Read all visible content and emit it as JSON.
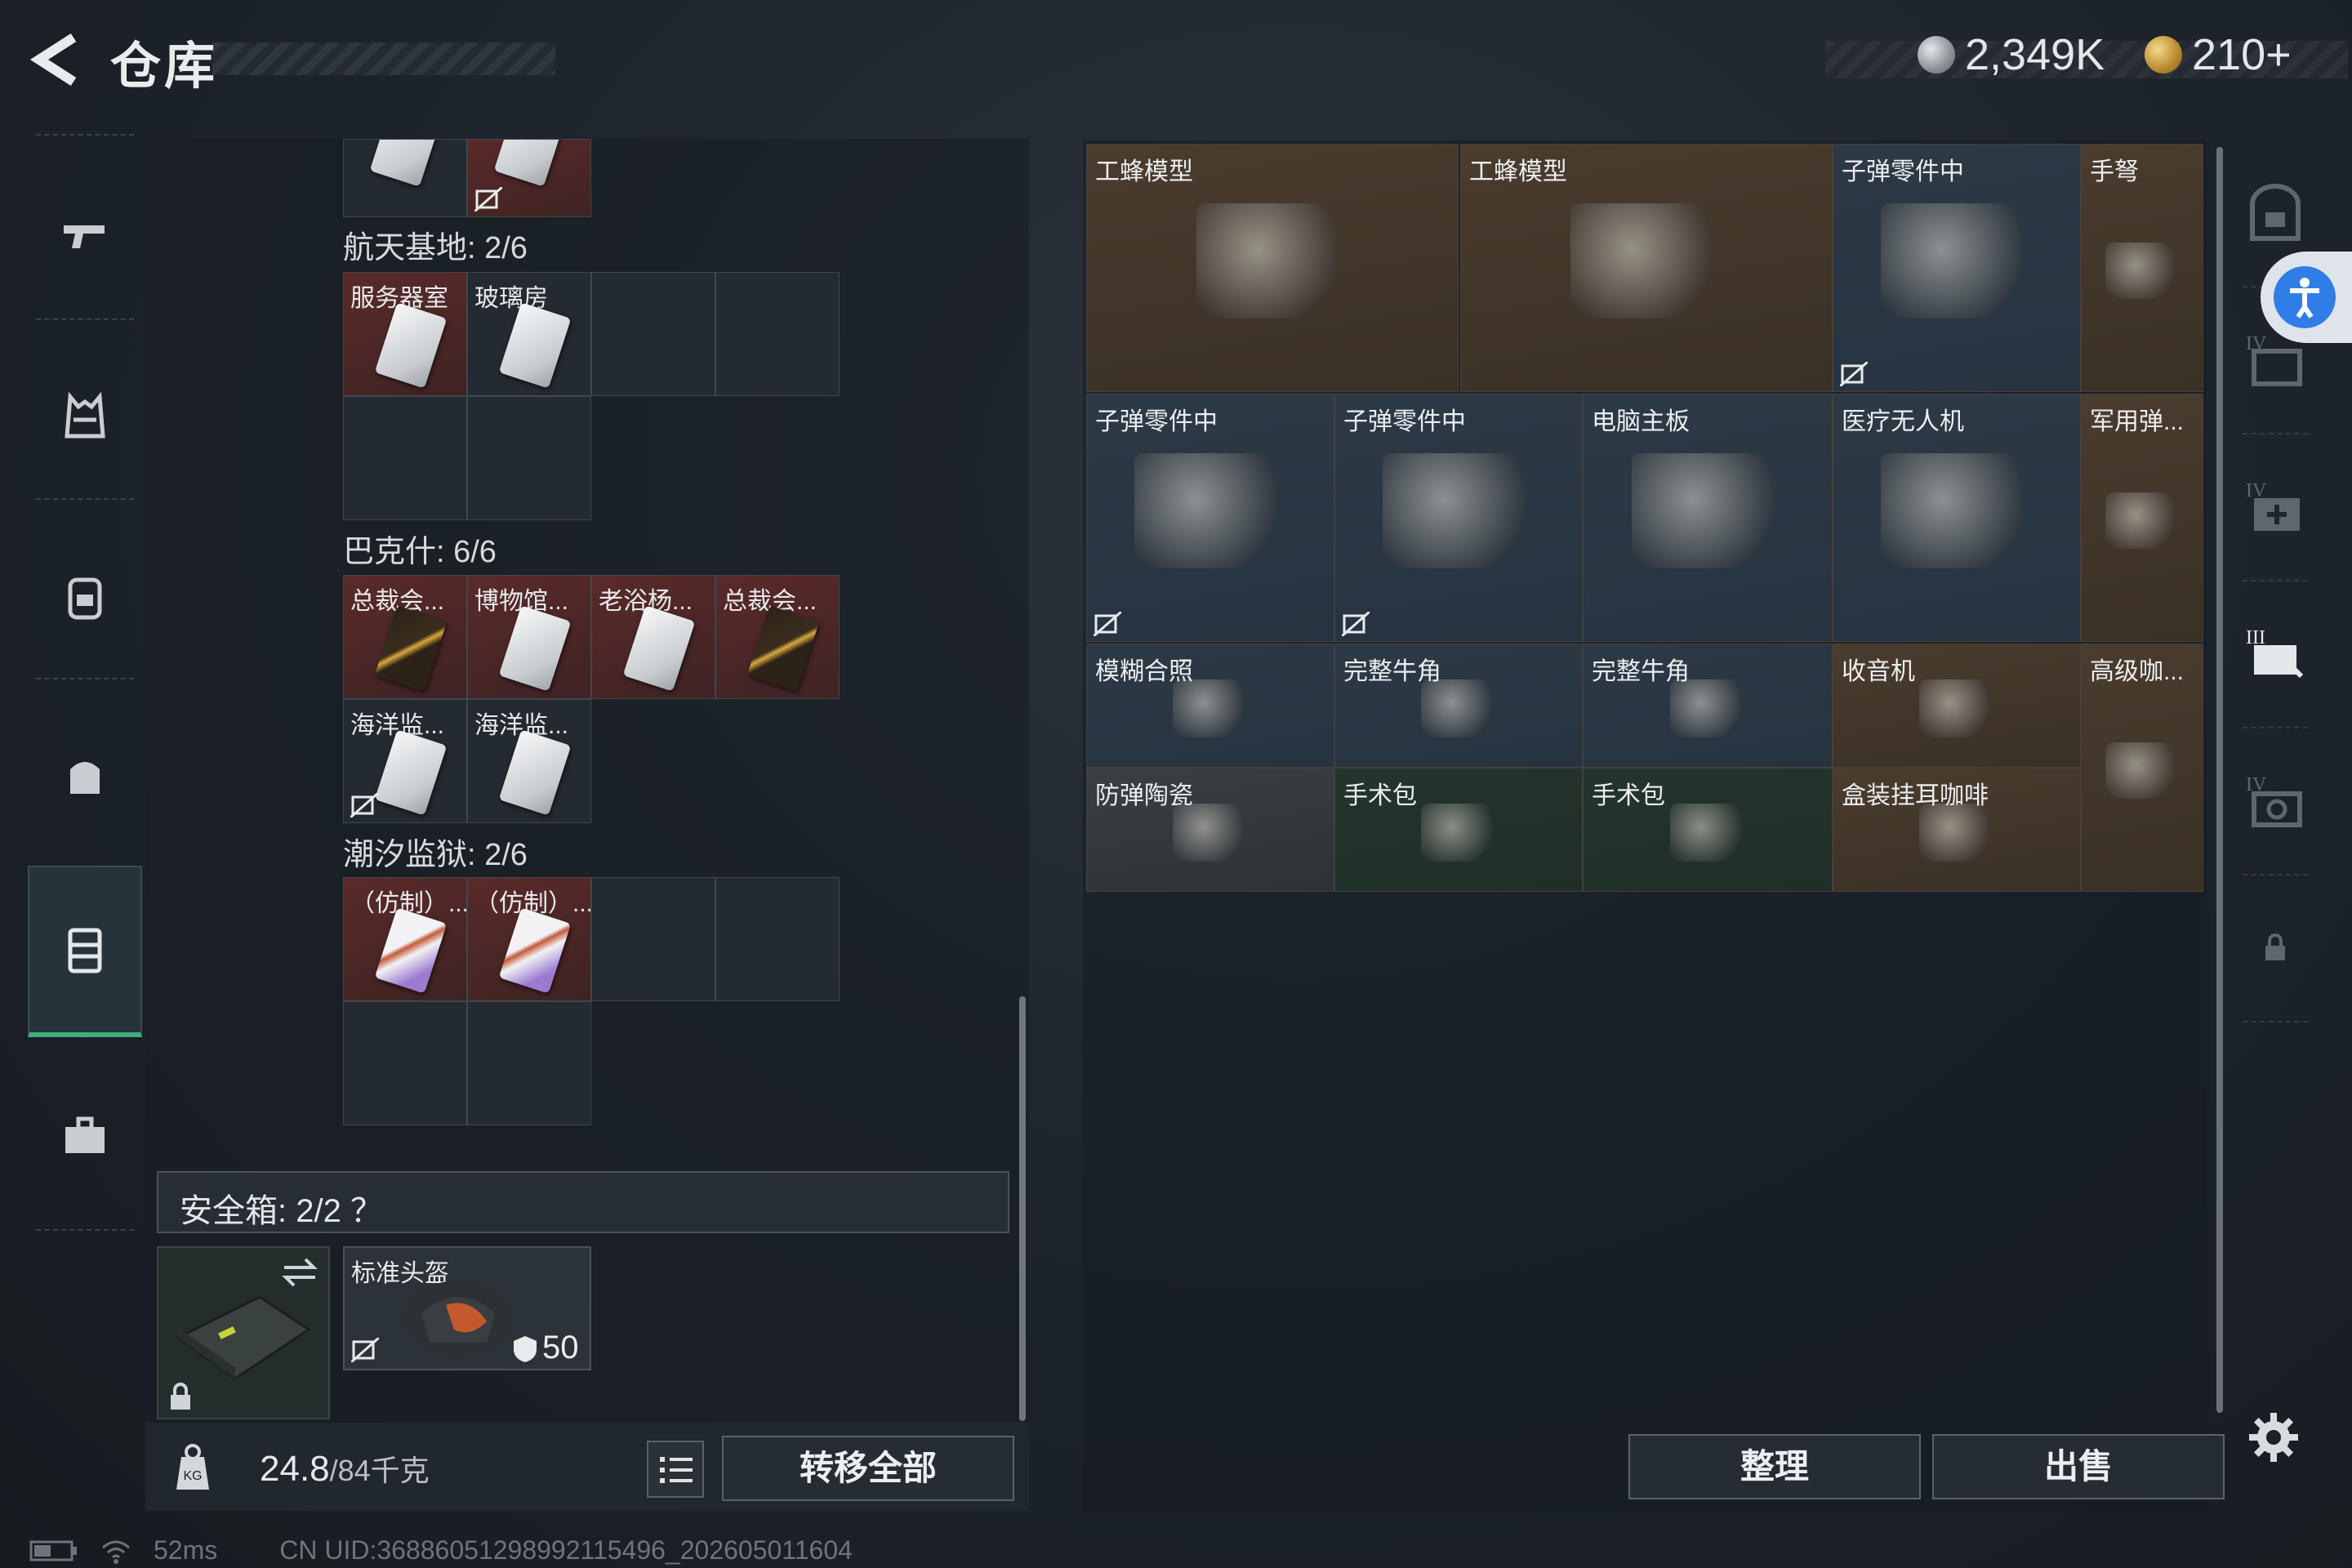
{
  "header": {
    "title": "仓库",
    "currency_silver": "2,349K",
    "currency_gold": "210+"
  },
  "left_nav": [
    "weapon",
    "armor",
    "backpack",
    "chest-rig",
    "container",
    "toolbox"
  ],
  "stash_sections": [
    {
      "label": "航天基地: 2/6",
      "items": [
        {
          "name": "服务器室",
          "style": "red",
          "card": "white"
        },
        {
          "name": "玻璃房",
          "style": "dark",
          "card": "white"
        }
      ]
    },
    {
      "label": "巴克什: 6/6",
      "items": [
        {
          "name": "总裁会...",
          "style": "red",
          "card": "gold"
        },
        {
          "name": "博物馆...",
          "style": "red",
          "card": "white"
        },
        {
          "name": "老浴杨...",
          "style": "red",
          "card": "white"
        },
        {
          "name": "总裁会...",
          "style": "red",
          "card": "gold"
        },
        {
          "name": "海洋监...",
          "style": "dark",
          "card": "white"
        },
        {
          "name": "海洋监...",
          "style": "dark",
          "card": "white"
        }
      ]
    },
    {
      "label": "潮汐监狱: 2/6",
      "items": [
        {
          "name": "（仿制）...",
          "style": "red",
          "card": "purple"
        },
        {
          "name": "（仿制）...",
          "style": "red",
          "card": "purple"
        }
      ]
    }
  ],
  "safebox": {
    "label": "安全箱:  2/2  ？",
    "helmet_name": "标准头盔",
    "helmet_durability": "50"
  },
  "bottom": {
    "weight_current": "24.8",
    "weight_max": "/84千克",
    "transfer_all": "转移全部",
    "organize": "整理",
    "sell": "出售"
  },
  "inventory_items": [
    {
      "name": "工蜂模型",
      "style": "brown"
    },
    {
      "name": "工蜂模型",
      "style": "brown"
    },
    {
      "name": "子弹零件中",
      "style": "bluish"
    },
    {
      "name": "手弩",
      "style": "brown"
    },
    {
      "name": "子弹零件中",
      "style": "bluish"
    },
    {
      "name": "子弹零件中",
      "style": "bluish"
    },
    {
      "name": "电脑主板",
      "style": "bluish"
    },
    {
      "name": "医疗无人机",
      "style": "bluish"
    },
    {
      "name": "军用弹...",
      "style": "brown"
    },
    {
      "name": "模糊合照",
      "style": "bluish"
    },
    {
      "name": "完整牛角",
      "style": "bluish"
    },
    {
      "name": "完整牛角",
      "style": "bluish"
    },
    {
      "name": "收音机",
      "style": "brown"
    },
    {
      "name": "高级咖...",
      "style": "brown"
    },
    {
      "name": "防弹陶瓷",
      "style": "greyish"
    },
    {
      "name": "手术包",
      "style": "greenish"
    },
    {
      "name": "手术包",
      "style": "greenish"
    },
    {
      "name": "盒装挂耳咖啡",
      "style": "brown"
    }
  ],
  "status_bar": {
    "ping": "52ms",
    "uid": "CN UID:3688605129899211549​6_202605011604"
  }
}
